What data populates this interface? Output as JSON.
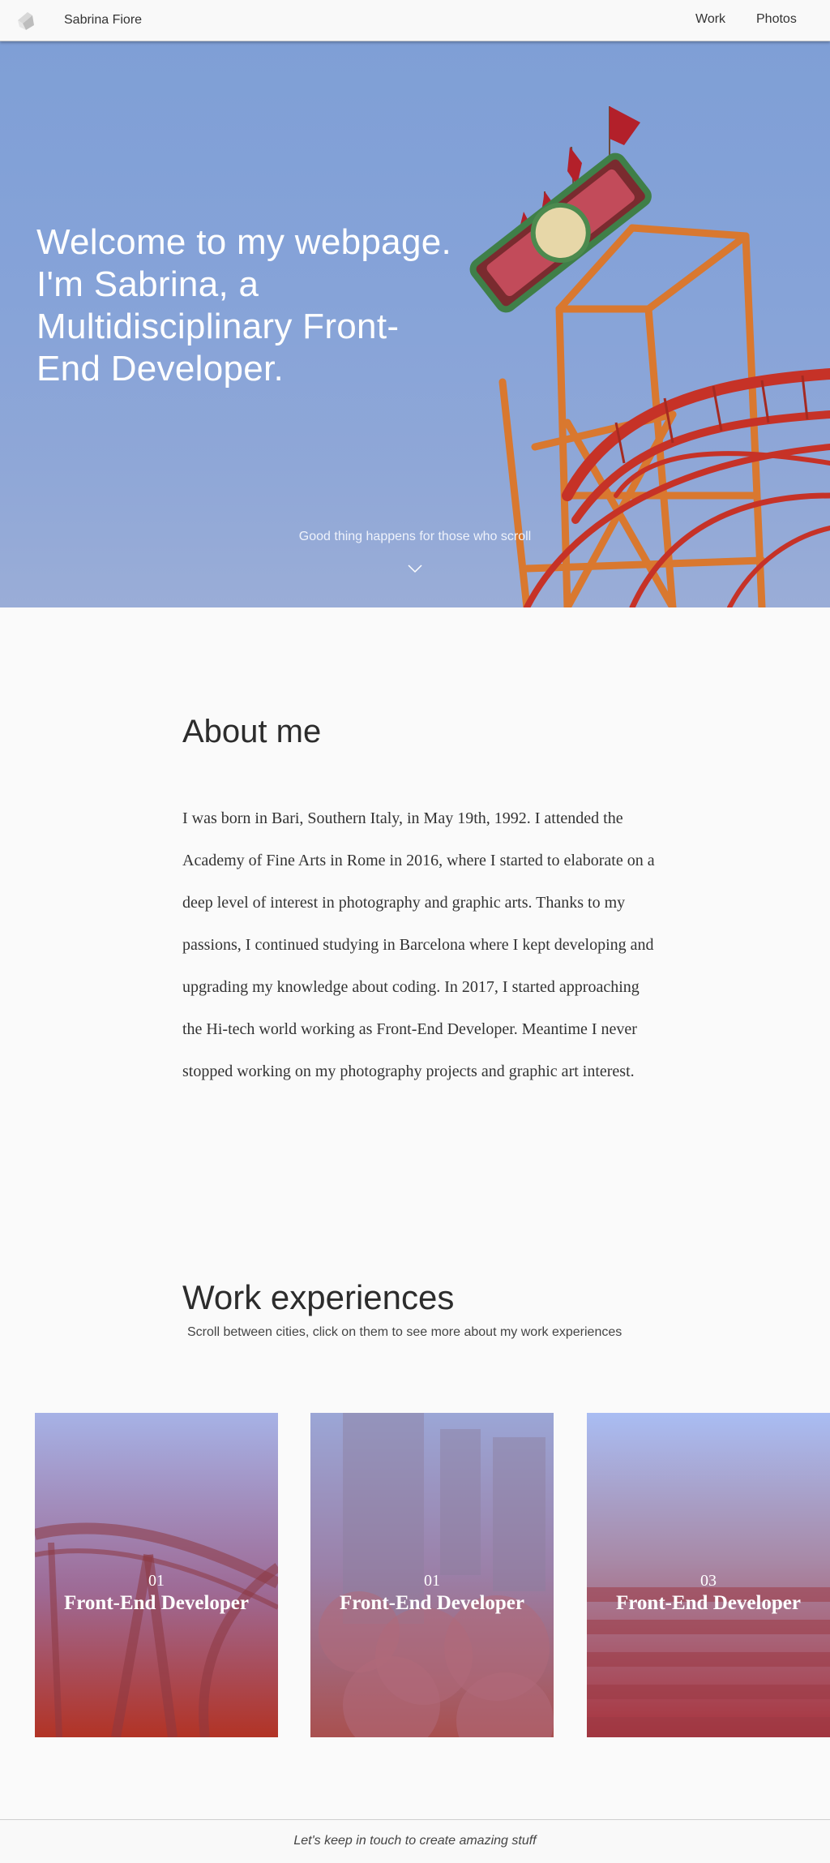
{
  "header": {
    "brand": "Sabrina Fiore",
    "nav": [
      {
        "label": "Work"
      },
      {
        "label": "Photos"
      }
    ]
  },
  "hero": {
    "title": "Welcome to my webpage. I'm Sabrina, a Multidisciplinary Front-End Developer.",
    "tagline": "Good thing happens for those who scroll"
  },
  "about": {
    "title": "About me",
    "text": "I was born in Bari, Southern Italy, in May 19th, 1992. I attended the Academy of Fine Arts in Rome in 2016, where I started to elaborate on a deep level of interest in photography and graphic arts. Thanks to my passions, I continued studying in Barcelona where I kept developing and upgrading my knowledge about coding. In 2017, I started approaching the Hi-tech world working as Front-End Developer. Meantime I never stopped working on my photography projects and graphic art interest."
  },
  "work": {
    "title": "Work experiences",
    "subtitle": "Scroll between cities, click on them to see more about my work experiences",
    "cards": [
      {
        "number": "01",
        "role": "Front-End Developer"
      },
      {
        "number": "01",
        "role": "Front-End Developer"
      },
      {
        "number": "03",
        "role": "Front-End Developer"
      }
    ]
  },
  "footer": {
    "text": "Let's keep in touch to create amazing stuff"
  },
  "colors": {
    "sky": "#7f9fd6",
    "ride_orange": "#d9782f",
    "track_red": "#c63227",
    "card_top": "#a6b2e6",
    "card_bottom": "#b23325"
  }
}
